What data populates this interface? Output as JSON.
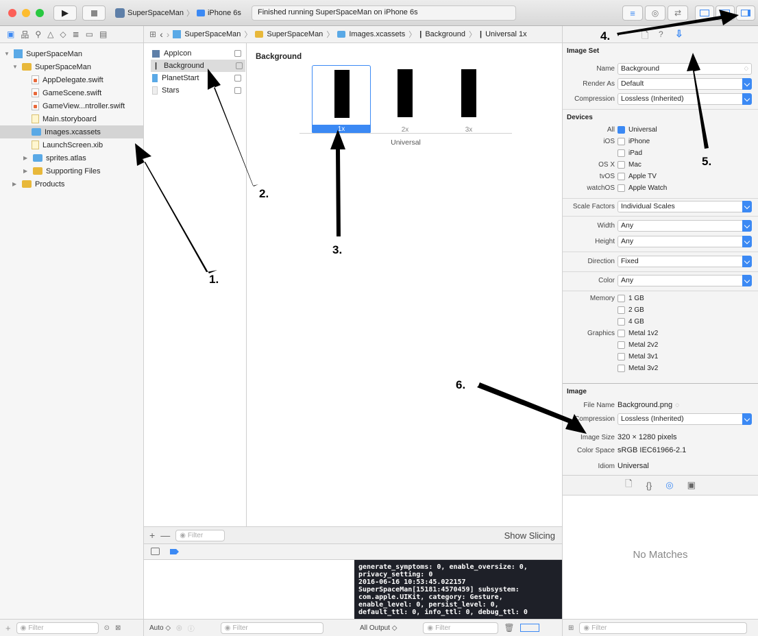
{
  "toolbar": {
    "scheme_target": "SuperSpaceMan",
    "device": "iPhone 6s",
    "status": "Finished running SuperSpaceMan on iPhone 6s"
  },
  "navigator": {
    "items": [
      {
        "label": "SuperSpaceMan"
      },
      {
        "label": "SuperSpaceMan"
      },
      {
        "label": "AppDelegate.swift"
      },
      {
        "label": "GameScene.swift"
      },
      {
        "label": "GameView...ntroller.swift"
      },
      {
        "label": "Main.storyboard"
      },
      {
        "label": "Images.xcassets"
      },
      {
        "label": "LaunchScreen.xib"
      },
      {
        "label": "sprites.atlas"
      },
      {
        "label": "Supporting Files"
      },
      {
        "label": "Products"
      }
    ],
    "filter_placeholder": "Filter"
  },
  "jumpbar": {
    "crumbs": [
      "SuperSpaceMan",
      "SuperSpaceMan",
      "Images.xcassets",
      "Background",
      "Universal 1x"
    ]
  },
  "assets": {
    "items": [
      "AppIcon",
      "Background",
      "PlanetStart",
      "Stars"
    ],
    "filter_placeholder": "Filter"
  },
  "canvas": {
    "title": "Background",
    "slots": [
      "1x",
      "2x",
      "3x"
    ],
    "group_label": "Universal",
    "show_slicing": "Show Slicing"
  },
  "inspector": {
    "image_set_header": "Image Set",
    "name_label": "Name",
    "name_value": "Background",
    "render_as_label": "Render As",
    "render_as_value": "Default",
    "compression_label": "Compression",
    "compression_value": "Lossless (Inherited)",
    "devices_header": "Devices",
    "devices": [
      {
        "group": "All",
        "label": "Universal",
        "checked": true
      },
      {
        "group": "iOS",
        "label": "iPhone",
        "checked": false
      },
      {
        "group": "",
        "label": "iPad",
        "checked": false
      },
      {
        "group": "OS X",
        "label": "Mac",
        "checked": false
      },
      {
        "group": "tvOS",
        "label": "Apple TV",
        "checked": false
      },
      {
        "group": "watchOS",
        "label": "Apple Watch",
        "checked": false
      }
    ],
    "scale_factors_label": "Scale Factors",
    "scale_factors_value": "Individual Scales",
    "width_label": "Width",
    "width_value": "Any",
    "height_label": "Height",
    "height_value": "Any",
    "direction_label": "Direction",
    "direction_value": "Fixed",
    "color_label": "Color",
    "color_value": "Any",
    "memory_label": "Memory",
    "memory": [
      "1 GB",
      "2 GB",
      "4 GB"
    ],
    "graphics_label": "Graphics",
    "graphics": [
      "Metal 1v2",
      "Metal 2v2",
      "Metal 3v1",
      "Metal 3v2"
    ],
    "image_header": "Image",
    "file_name_label": "File Name",
    "file_name_value": "Background.png",
    "image_compression_label": "Compression",
    "image_compression_value": "Lossless (Inherited)",
    "image_size_label": "Image Size",
    "image_size_value": "320 × 1280 pixels",
    "color_space_label": "Color Space",
    "color_space_value": "sRGB IEC61966-2.1",
    "idiom_label": "Idiom",
    "idiom_value": "Universal"
  },
  "library": {
    "empty_text": "No Matches",
    "filter_placeholder": "Filter"
  },
  "debug": {
    "auto_label": "Auto ◇",
    "output_label": "All Output ◇",
    "filter_placeholder": "Filter",
    "console_text": "generate_symptoms: 0, enable_oversize: 0,\nprivacy_setting: 0\n2016-06-16 10:53:45.022157\nSuperSpaceMan[15181:4570459] subsystem:\ncom.apple.UIKit, category: Gesture,\nenable_level: 0, persist_level: 0,\ndefault_ttl: 0, info_ttl: 0, debug_ttl: 0"
  },
  "callouts": [
    "1.",
    "2.",
    "3.",
    "4.",
    "5.",
    "6."
  ],
  "colors": {
    "accent": "#3b89f4",
    "folder": "#e8b83a",
    "console_bg": "#1e2028"
  }
}
